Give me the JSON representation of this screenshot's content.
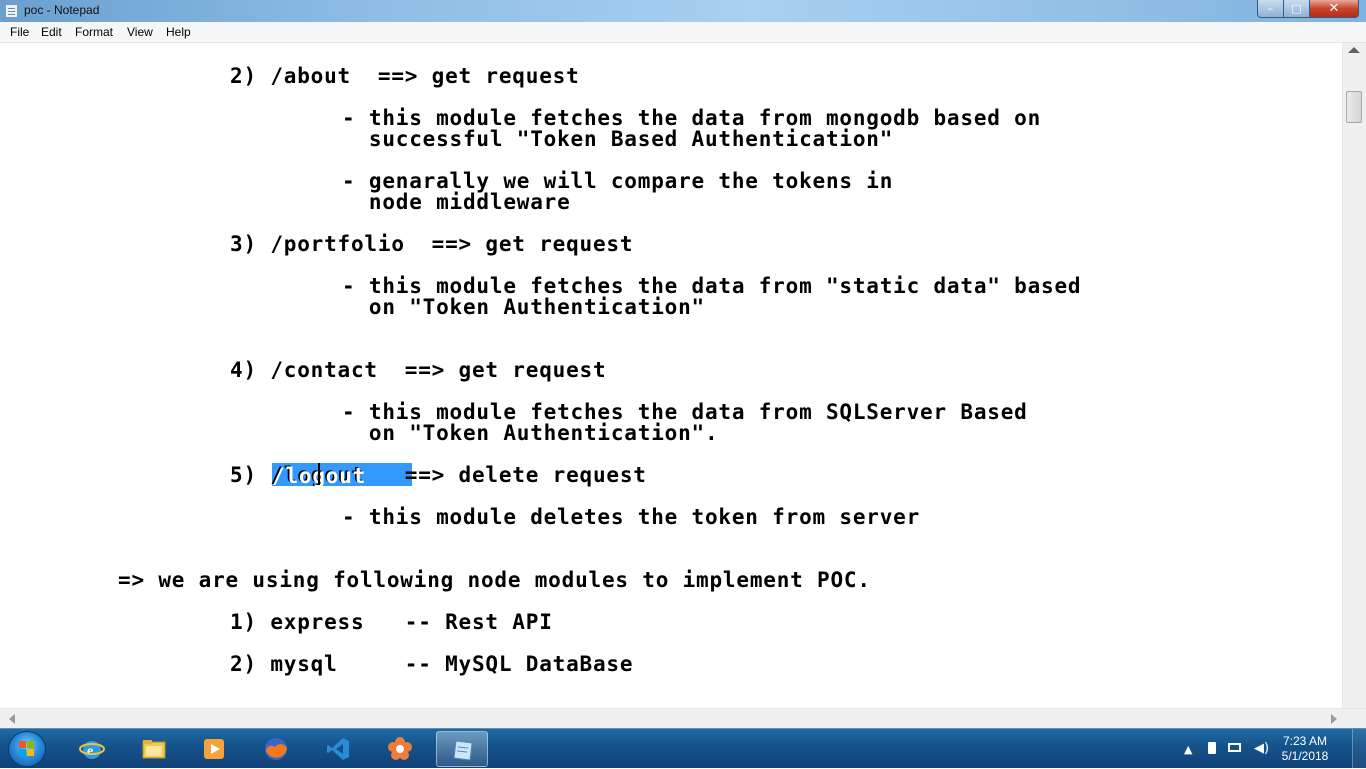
{
  "window": {
    "title": "poc - Notepad",
    "minimize_glyph": "–",
    "maximize_glyph": "□",
    "close_glyph": "✕"
  },
  "menu": [
    "File",
    "Edit",
    "Format",
    "View",
    "Help"
  ],
  "editor": {
    "lines": [
      "2) /about  ==> get request",
      "- this module fetches the data from mongodb based on",
      "  successful \"Token Based Authentication\"",
      "- genarally we will compare the tokens in",
      "  node middleware",
      "3) /portfolio  ==> get request",
      "- this module fetches the data from \"static data\" based",
      "  on \"Token Authentication\"",
      "4) /contact  ==> get request",
      "- this module fetches the data from SQLServer Based",
      "  on \"Token Authentication\".",
      "5) /logout   ==> delete request",
      "- this module deletes the token from server",
      "=> we are using following node modules to implement POC.",
      "1) express   -- Rest API",
      "2) mysql     -- MySQL DataBase"
    ],
    "selection_text": "/logout"
  },
  "taskbar": {
    "apps": [
      "internet-explorer",
      "windows-explorer",
      "media-player",
      "firefox",
      "visual-studio-code",
      "app-flower",
      "notepad"
    ],
    "active_app": "notepad",
    "clock_time": "7:23 AM",
    "clock_date": "5/1/2018"
  },
  "colors": {
    "selection": "#3399ff",
    "taskbar": "#15528a",
    "close_button": "#c7442d"
  }
}
